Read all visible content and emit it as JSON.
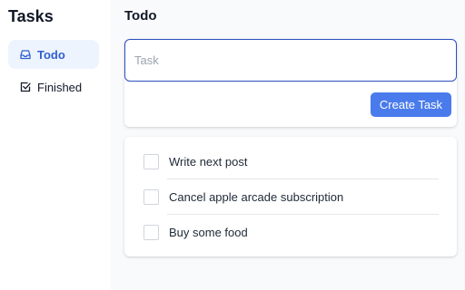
{
  "sidebar": {
    "title": "Tasks",
    "items": [
      {
        "label": "Todo",
        "icon": "inbox-icon",
        "active": true
      },
      {
        "label": "Finished",
        "icon": "check-square-icon",
        "active": false
      }
    ]
  },
  "main": {
    "title": "Todo",
    "input": {
      "placeholder": "Task",
      "value": ""
    },
    "create_button_label": "Create Task",
    "tasks": [
      {
        "label": "Write next post",
        "checked": false
      },
      {
        "label": "Cancel apple arcade subscription",
        "checked": false
      },
      {
        "label": "Buy some food",
        "checked": false
      }
    ]
  },
  "colors": {
    "accent": "#4a7bec",
    "active_nav_bg": "#eef4fe",
    "active_nav_text": "#2f5fd0",
    "focus_border": "#2c4fc0"
  }
}
